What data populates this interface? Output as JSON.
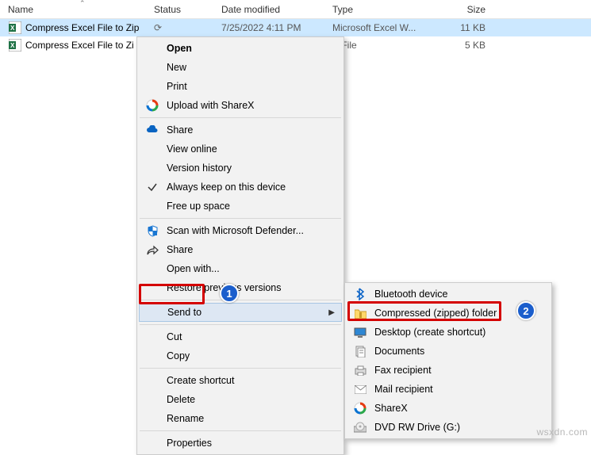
{
  "columns": {
    "name": "Name",
    "status": "Status",
    "date": "Date modified",
    "type": "Type",
    "size": "Size"
  },
  "files": [
    {
      "name": "Compress Excel File to Zip",
      "status": "⟳",
      "date": "7/25/2022 4:11 PM",
      "type": "Microsoft Excel W...",
      "size": "11 KB",
      "icon": "excel",
      "selected": true
    },
    {
      "name": "Compress Excel File to Zi",
      "status": "",
      "date": "",
      "type": "S File",
      "size": "5 KB",
      "icon": "excel",
      "selected": false
    }
  ],
  "menu": [
    {
      "label": "Open",
      "icon": "",
      "bold": true
    },
    {
      "label": "New",
      "icon": ""
    },
    {
      "label": "Print",
      "icon": ""
    },
    {
      "label": "Upload with ShareX",
      "icon": "sharex"
    },
    {
      "sep": true
    },
    {
      "label": "Share",
      "icon": "cloud"
    },
    {
      "label": "View online",
      "icon": ""
    },
    {
      "label": "Version history",
      "icon": ""
    },
    {
      "label": "Always keep on this device",
      "icon": "check"
    },
    {
      "label": "Free up space",
      "icon": ""
    },
    {
      "sep": true
    },
    {
      "label": "Scan with Microsoft Defender...",
      "icon": "defender"
    },
    {
      "label": "Share",
      "icon": "share"
    },
    {
      "label": "Open with...",
      "icon": ""
    },
    {
      "label": "Restore previous versions",
      "icon": ""
    },
    {
      "sep": true
    },
    {
      "label": "Send to",
      "icon": "",
      "submenu": true,
      "hover": true
    },
    {
      "sep": true
    },
    {
      "label": "Cut",
      "icon": ""
    },
    {
      "label": "Copy",
      "icon": ""
    },
    {
      "sep": true
    },
    {
      "label": "Create shortcut",
      "icon": ""
    },
    {
      "label": "Delete",
      "icon": ""
    },
    {
      "label": "Rename",
      "icon": ""
    },
    {
      "sep": true
    },
    {
      "label": "Properties",
      "icon": ""
    }
  ],
  "submenu": [
    {
      "label": "Bluetooth device",
      "icon": "bluetooth"
    },
    {
      "label": "Compressed (zipped) folder",
      "icon": "zip"
    },
    {
      "label": "Desktop (create shortcut)",
      "icon": "desktop"
    },
    {
      "label": "Documents",
      "icon": "docs"
    },
    {
      "label": "Fax recipient",
      "icon": "fax"
    },
    {
      "label": "Mail recipient",
      "icon": "mail"
    },
    {
      "label": "ShareX",
      "icon": "sharex"
    },
    {
      "label": "DVD RW Drive (G:)",
      "icon": "dvd"
    }
  ],
  "annotations": {
    "one": "1",
    "two": "2"
  },
  "watermark": "wsxdn.com"
}
